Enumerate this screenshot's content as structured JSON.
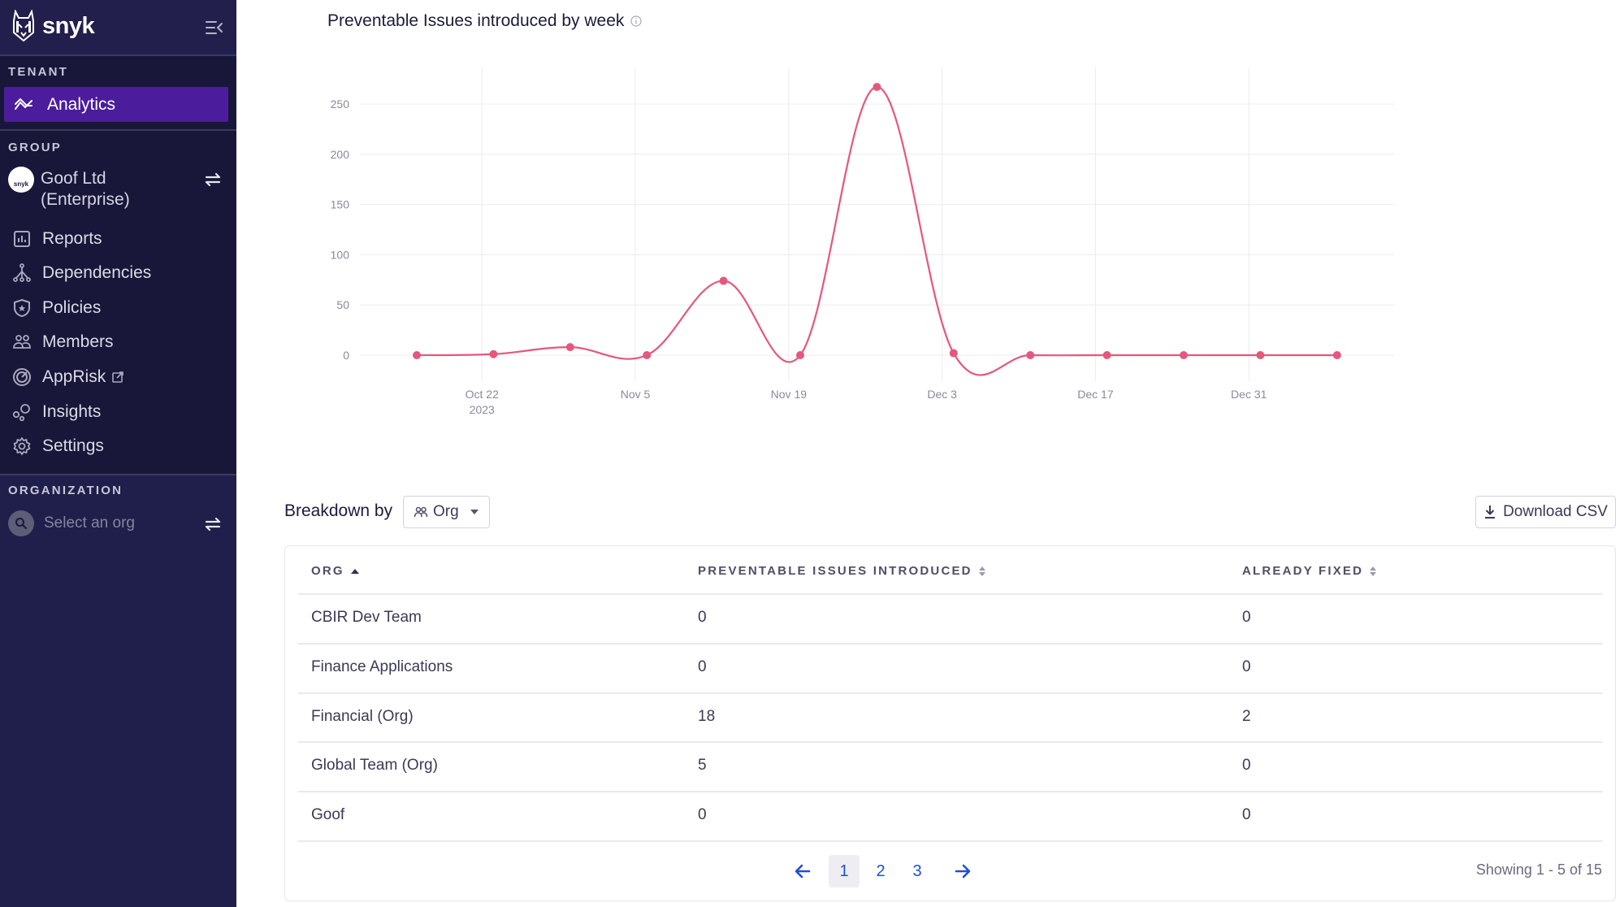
{
  "sidebar": {
    "brand": "snyk",
    "tenant_label": "TENANT",
    "analytics_label": "Analytics",
    "group_label": "GROUP",
    "group_name_line1": "Goof Ltd",
    "group_name_line2": "(Enterprise)",
    "group_avatar_text": "snyk",
    "items": [
      {
        "label": "Reports",
        "icon": "reports-icon"
      },
      {
        "label": "Dependencies",
        "icon": "dependencies-icon"
      },
      {
        "label": "Policies",
        "icon": "policies-icon"
      },
      {
        "label": "Members",
        "icon": "members-icon"
      },
      {
        "label": "AppRisk",
        "icon": "apprisk-icon",
        "external": true
      },
      {
        "label": "Insights",
        "icon": "insights-icon"
      },
      {
        "label": "Settings",
        "icon": "settings-icon"
      }
    ],
    "organization_label": "ORGANIZATION",
    "org_search_placeholder": "Select an org"
  },
  "main": {
    "breakdown_label": "Breakdown by",
    "breakdown_value": "Org",
    "download_label": "Download CSV",
    "table": {
      "headers": [
        "ORG",
        "PREVENTABLE ISSUES INTRODUCED",
        "ALREADY FIXED"
      ],
      "rows": [
        [
          "CBIR Dev Team",
          "0",
          "0"
        ],
        [
          "Finance Applications",
          "0",
          "0"
        ],
        [
          "Financial (Org)",
          "18",
          "2"
        ],
        [
          "Global Team (Org)",
          "5",
          "0"
        ],
        [
          "Goof",
          "0",
          "0"
        ]
      ]
    },
    "pagination": {
      "pages": [
        "1",
        "2",
        "3"
      ],
      "current": "1",
      "showing": "Showing 1 - 5 of 15"
    }
  },
  "colors": {
    "accent": "#4b1d9c",
    "line": "#e5577d",
    "link": "#1e50d6"
  },
  "chart_data": {
    "type": "line",
    "title": "Preventable Issues introduced by week",
    "xlabel": "",
    "ylabel": "",
    "ylim": [
      0,
      280
    ],
    "yticks": [
      0,
      50,
      100,
      150,
      200,
      250
    ],
    "xtick_labels": [
      {
        "label": "Oct 22",
        "sub": "2023",
        "week": 0.85
      },
      {
        "label": "Nov 5",
        "sub": "",
        "week": 2.85
      },
      {
        "label": "Nov 19",
        "sub": "",
        "week": 4.85
      },
      {
        "label": "Dec 3",
        "sub": "",
        "week": 6.85
      },
      {
        "label": "Dec 17",
        "sub": "",
        "week": 8.85
      },
      {
        "label": "Dec 31",
        "sub": "",
        "week": 10.85
      }
    ],
    "x_range_weeks": [
      -0.75,
      12.75
    ],
    "grid": true,
    "series": [
      {
        "name": "Preventable Issues",
        "values": [
          0,
          1,
          8,
          0,
          74,
          0,
          267,
          2,
          0,
          0,
          0,
          0,
          0
        ]
      }
    ]
  }
}
